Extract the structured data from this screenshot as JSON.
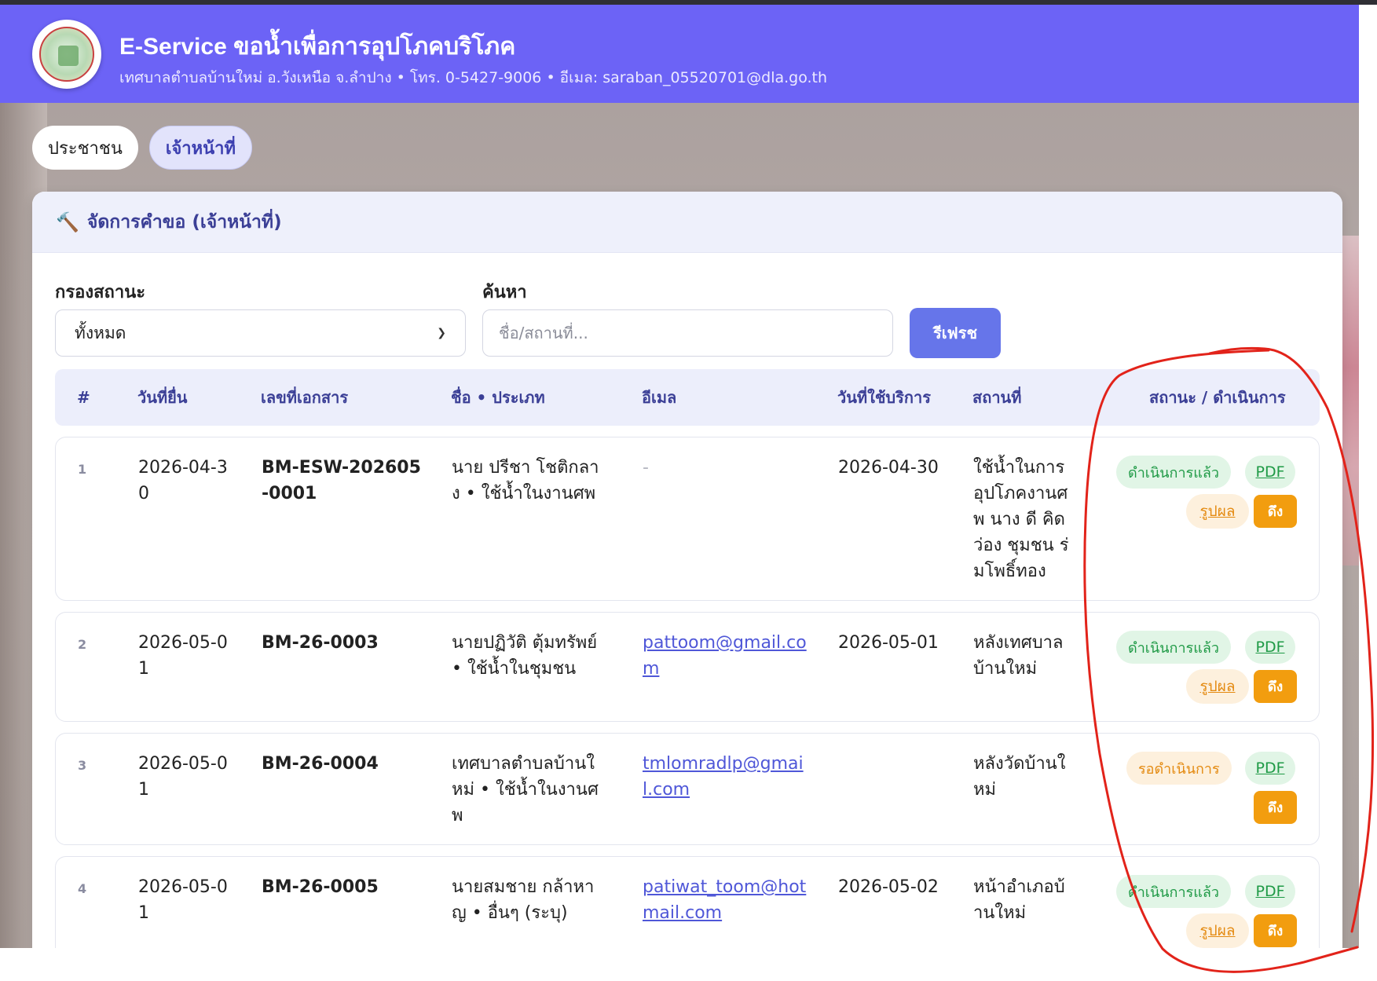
{
  "header": {
    "title": "E-Service ขอน้ำเพื่อการอุปโภคบริโภค",
    "subtitle": "เทศบาลตำบลบ้านใหม่ อ.วังเหนือ จ.ลำปาง • โทร. 0-5427-9006 • อีเมล: saraban_05520701@dla.go.th",
    "brand_color": "#6c63f6"
  },
  "tabs": [
    {
      "label": "ประชาชน"
    },
    {
      "label": "เจ้าหน้าที่"
    }
  ],
  "panel": {
    "icon": "tools-icon",
    "title": "จัดการคำขอ (เจ้าหน้าที่)"
  },
  "filters": {
    "status_label": "กรองสถานะ",
    "status_value": "ทั้งหมด",
    "search_label": "ค้นหา",
    "search_placeholder": "ชื่อ/สถานที่...",
    "search_value": "",
    "refresh_label": "รีเฟรช"
  },
  "table": {
    "headers": [
      "#",
      "วันที่ยื่น",
      "เลขที่เอกสาร",
      "ชื่อ • ประเภท",
      "อีเมล",
      "วันที่ใช้บริการ",
      "สถานที่",
      "สถานะ / ดำเนินการ"
    ],
    "rows": [
      {
        "no": "1",
        "date_lines": [
          "2026-04-3",
          "0"
        ],
        "doc_lines": [
          "BM-ESW-202605",
          "-0001"
        ],
        "name_lines": [
          "นาย ปรีชา โชติกลา",
          "ง • ใช้น้ำในงานศพ"
        ],
        "email_lines": [
          "-"
        ],
        "service_date": "2026-04-30",
        "place_lines": [
          "ใช้น้ำในการ",
          "อุปโภคงานศ",
          "พ นาง ดี คิด",
          "ว่อง ชุมชน ร่",
          "มโพธิ์ทอง"
        ],
        "status": "ดำเนินการแล้ว",
        "pdf": "PDF",
        "result": "รูปผล",
        "pull": "ดึง"
      },
      {
        "no": "2",
        "date_lines": [
          "2026-05-0",
          "1"
        ],
        "doc_lines": [
          "BM-26-0003"
        ],
        "name_lines": [
          "นายปฏิวัติ ตุ้มทรัพย์",
          "• ใช้น้ำในชุมชน"
        ],
        "email_lines": [
          "pattoom@gmail.co",
          "m"
        ],
        "service_date": "2026-05-01",
        "place_lines": [
          "หลังเทศบาล",
          "บ้านใหม่"
        ],
        "status": "ดำเนินการแล้ว",
        "pdf": "PDF",
        "result": "รูปผล",
        "pull": "ดึง"
      },
      {
        "no": "3",
        "date_lines": [
          "2026-05-0",
          "1"
        ],
        "doc_lines": [
          "BM-26-0004"
        ],
        "name_lines": [
          "เทศบาลตำบลบ้านใ",
          "หม่ • ใช้น้ำในงานศ",
          "พ"
        ],
        "email_lines": [
          "tmlomradlp@gmai",
          "l.com"
        ],
        "service_date": "",
        "place_lines": [
          "หลังวัดบ้านใ",
          "หม่"
        ],
        "status": "รอดำเนินการ",
        "pdf": "PDF",
        "pull": "ดึง"
      },
      {
        "no": "4",
        "date_lines": [
          "2026-05-0",
          "1"
        ],
        "doc_lines": [
          "BM-26-0005"
        ],
        "name_lines": [
          "นายสมชาย กล้าหา",
          "ญ • อื่นๆ (ระบุ)"
        ],
        "email_lines": [
          "patiwat_toom@hot",
          "mail.com"
        ],
        "service_date": "2026-05-02",
        "place_lines": [
          "หน้าอำเภอบ้",
          "านใหม่"
        ],
        "status": "ดำเนินการแล้ว",
        "pdf": "PDF",
        "result": "รูปผล",
        "pull": "ดึง"
      }
    ]
  }
}
